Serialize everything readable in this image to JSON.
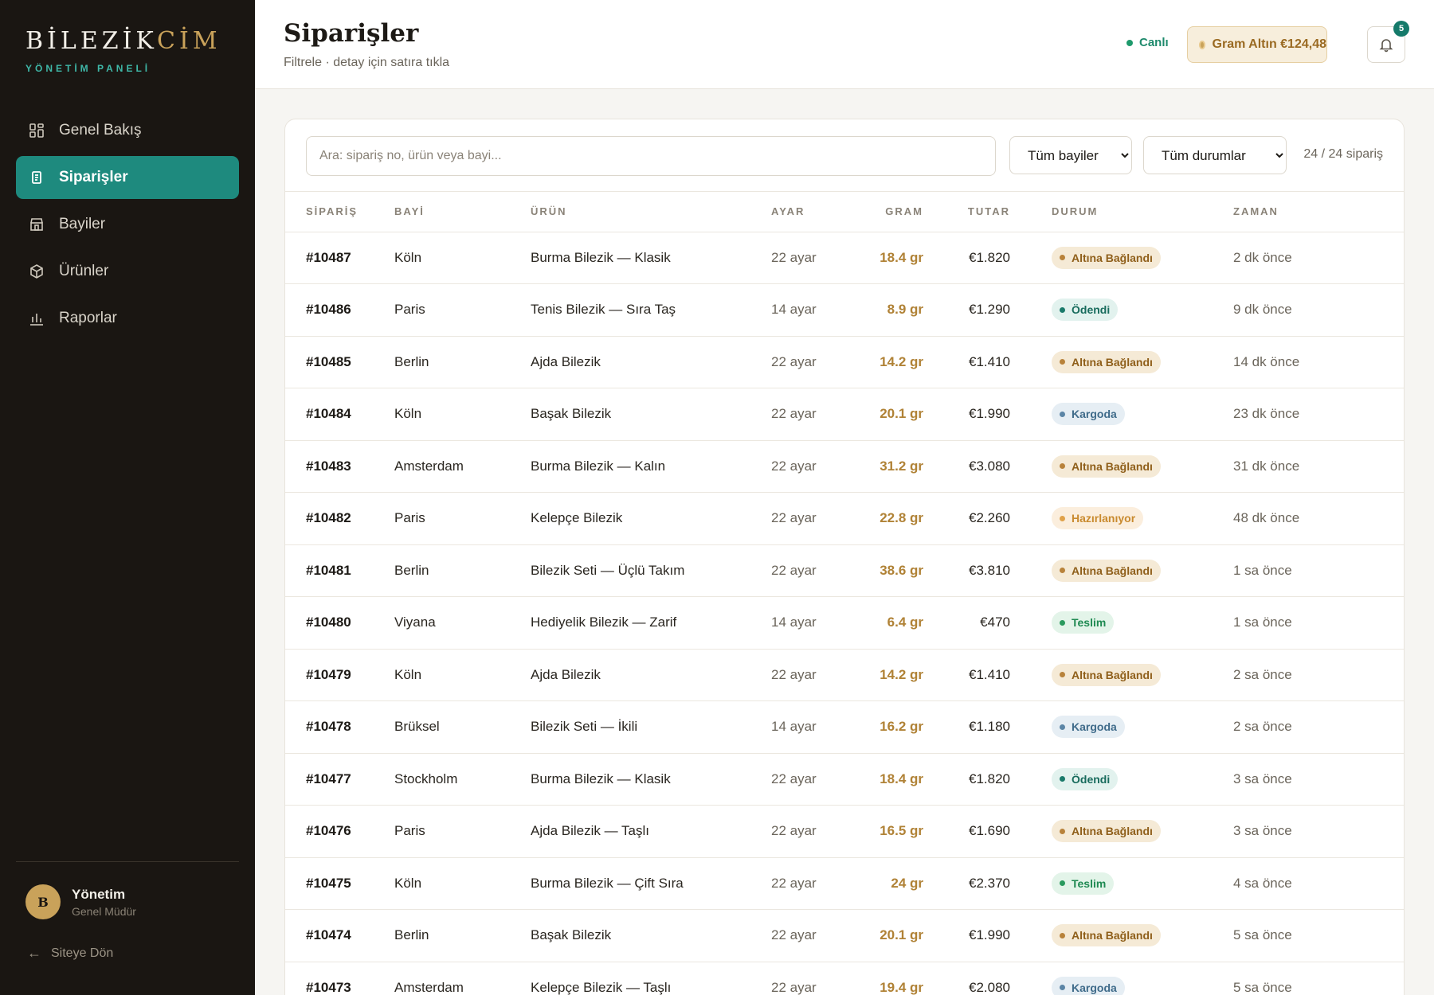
{
  "brand": {
    "name_main": "BİLEZİK",
    "name_accent": "CİM",
    "subtitle": "YÖNETİM PANELİ"
  },
  "nav": [
    {
      "label": "Genel Bakış",
      "icon": "dashboard-icon",
      "active": false
    },
    {
      "label": "Siparişler",
      "icon": "orders-icon",
      "active": true
    },
    {
      "label": "Bayiler",
      "icon": "store-icon",
      "active": false
    },
    {
      "label": "Ürünler",
      "icon": "box-icon",
      "active": false
    },
    {
      "label": "Raporlar",
      "icon": "chart-icon",
      "active": false
    }
  ],
  "user": {
    "initial": "B",
    "name": "Yönetim",
    "role": "Genel Müdür"
  },
  "back_link": "Siteye Dön",
  "header": {
    "title": "Siparişler",
    "subtitle": "Filtrele · detay için satıra tıkla",
    "live_label": "Canlı",
    "gold_price": "Gram Altın €124,48",
    "notification_count": "5"
  },
  "filters": {
    "search_placeholder": "Ara: sipariş no, ürün veya bayi...",
    "dealer_selected": "Tüm bayiler",
    "status_selected": "Tüm durumlar",
    "count": "24 / 24 sipariş"
  },
  "table": {
    "columns": [
      "SİPARİŞ",
      "BAYİ",
      "ÜRÜN",
      "AYAR",
      "GRAM",
      "TUTAR",
      "DURUM",
      "ZAMAN"
    ],
    "rows": [
      {
        "id": "#10487",
        "dealer": "Köln",
        "product": "Burma Bilezik — Klasik",
        "karat": "22 ayar",
        "gram": "18.4 gr",
        "amount": "€1.820",
        "status": "Altına Bağlandı",
        "time": "2 dk önce"
      },
      {
        "id": "#10486",
        "dealer": "Paris",
        "product": "Tenis Bilezik — Sıra Taş",
        "karat": "14 ayar",
        "gram": "8.9 gr",
        "amount": "€1.290",
        "status": "Ödendi",
        "time": "9 dk önce"
      },
      {
        "id": "#10485",
        "dealer": "Berlin",
        "product": "Ajda Bilezik",
        "karat": "22 ayar",
        "gram": "14.2 gr",
        "amount": "€1.410",
        "status": "Altına Bağlandı",
        "time": "14 dk önce"
      },
      {
        "id": "#10484",
        "dealer": "Köln",
        "product": "Başak Bilezik",
        "karat": "22 ayar",
        "gram": "20.1 gr",
        "amount": "€1.990",
        "status": "Kargoda",
        "time": "23 dk önce"
      },
      {
        "id": "#10483",
        "dealer": "Amsterdam",
        "product": "Burma Bilezik — Kalın",
        "karat": "22 ayar",
        "gram": "31.2 gr",
        "amount": "€3.080",
        "status": "Altına Bağlandı",
        "time": "31 dk önce"
      },
      {
        "id": "#10482",
        "dealer": "Paris",
        "product": "Kelepçe Bilezik",
        "karat": "22 ayar",
        "gram": "22.8 gr",
        "amount": "€2.260",
        "status": "Hazırlanıyor",
        "time": "48 dk önce"
      },
      {
        "id": "#10481",
        "dealer": "Berlin",
        "product": "Bilezik Seti — Üçlü Takım",
        "karat": "22 ayar",
        "gram": "38.6 gr",
        "amount": "€3.810",
        "status": "Altına Bağlandı",
        "time": "1 sa önce"
      },
      {
        "id": "#10480",
        "dealer": "Viyana",
        "product": "Hediyelik Bilezik — Zarif",
        "karat": "14 ayar",
        "gram": "6.4 gr",
        "amount": "€470",
        "status": "Teslim",
        "time": "1 sa önce"
      },
      {
        "id": "#10479",
        "dealer": "Köln",
        "product": "Ajda Bilezik",
        "karat": "22 ayar",
        "gram": "14.2 gr",
        "amount": "€1.410",
        "status": "Altına Bağlandı",
        "time": "2 sa önce"
      },
      {
        "id": "#10478",
        "dealer": "Brüksel",
        "product": "Bilezik Seti — İkili",
        "karat": "14 ayar",
        "gram": "16.2 gr",
        "amount": "€1.180",
        "status": "Kargoda",
        "time": "2 sa önce"
      },
      {
        "id": "#10477",
        "dealer": "Stockholm",
        "product": "Burma Bilezik — Klasik",
        "karat": "22 ayar",
        "gram": "18.4 gr",
        "amount": "€1.820",
        "status": "Ödendi",
        "time": "3 sa önce"
      },
      {
        "id": "#10476",
        "dealer": "Paris",
        "product": "Ajda Bilezik — Taşlı",
        "karat": "22 ayar",
        "gram": "16.5 gr",
        "amount": "€1.690",
        "status": "Altına Bağlandı",
        "time": "3 sa önce"
      },
      {
        "id": "#10475",
        "dealer": "Köln",
        "product": "Burma Bilezik — Çift Sıra",
        "karat": "22 ayar",
        "gram": "24 gr",
        "amount": "€2.370",
        "status": "Teslim",
        "time": "4 sa önce"
      },
      {
        "id": "#10474",
        "dealer": "Berlin",
        "product": "Başak Bilezik",
        "karat": "22 ayar",
        "gram": "20.1 gr",
        "amount": "€1.990",
        "status": "Altına Bağlandı",
        "time": "5 sa önce"
      },
      {
        "id": "#10473",
        "dealer": "Amsterdam",
        "product": "Kelepçe Bilezik — Taşlı",
        "karat": "22 ayar",
        "gram": "19.4 gr",
        "amount": "€2.080",
        "status": "Kargoda",
        "time": "5 sa önce"
      }
    ]
  },
  "status_colors": {
    "Altına Bağlandı": {
      "bg": "#f5ead6",
      "fg": "#8f5f1a",
      "dot": "#b8823a"
    },
    "Ödendi": {
      "bg": "#e2f2ee",
      "fg": "#176b5c",
      "dot": "#1a7a6a"
    },
    "Kargoda": {
      "bg": "#e6eef4",
      "fg": "#3f6b8a",
      "dot": "#5b85a6"
    },
    "Hazırlanıyor": {
      "bg": "#fbeedd",
      "fg": "#c98a2e",
      "dot": "#e0a24a"
    },
    "Teslim": {
      "bg": "#e3f4e9",
      "fg": "#1f8a52",
      "dot": "#2a9a5e"
    }
  }
}
